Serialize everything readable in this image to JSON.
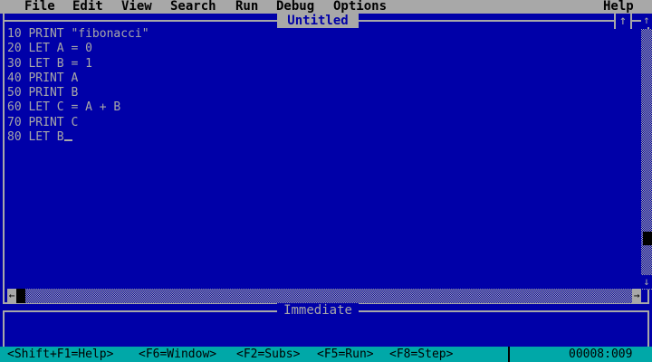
{
  "menu": {
    "file": "File",
    "edit": "Edit",
    "view": "View",
    "search": "Search",
    "run": "Run",
    "debug": "Debug",
    "options": "Options",
    "help": "Help"
  },
  "editor": {
    "title": "Untitled",
    "maximize_glyph": "↑",
    "lines": [
      "10 PRINT \"fibonacci\"",
      "20 LET A = 0",
      "30 LET B = 1",
      "40 PRINT A",
      "50 PRINT B",
      "60 LET C = A + B",
      "70 PRINT C",
      "80 LET B"
    ]
  },
  "scrollbar": {
    "up_glyph": "↑",
    "down_glyph": "↓",
    "left_glyph": "←",
    "right_glyph": "→"
  },
  "immediate": {
    "title": "Immediate"
  },
  "status": {
    "hints": [
      "<Shift+F1=Help>",
      "<F6=Window>",
      "<F2=Subs>",
      "<F5=Run>",
      "<F8=Step>"
    ],
    "cursor_position": "00008:009"
  },
  "colors": {
    "background": "#0000a8",
    "foreground": "#a8a8a8",
    "status_bar": "#00a8a8"
  }
}
